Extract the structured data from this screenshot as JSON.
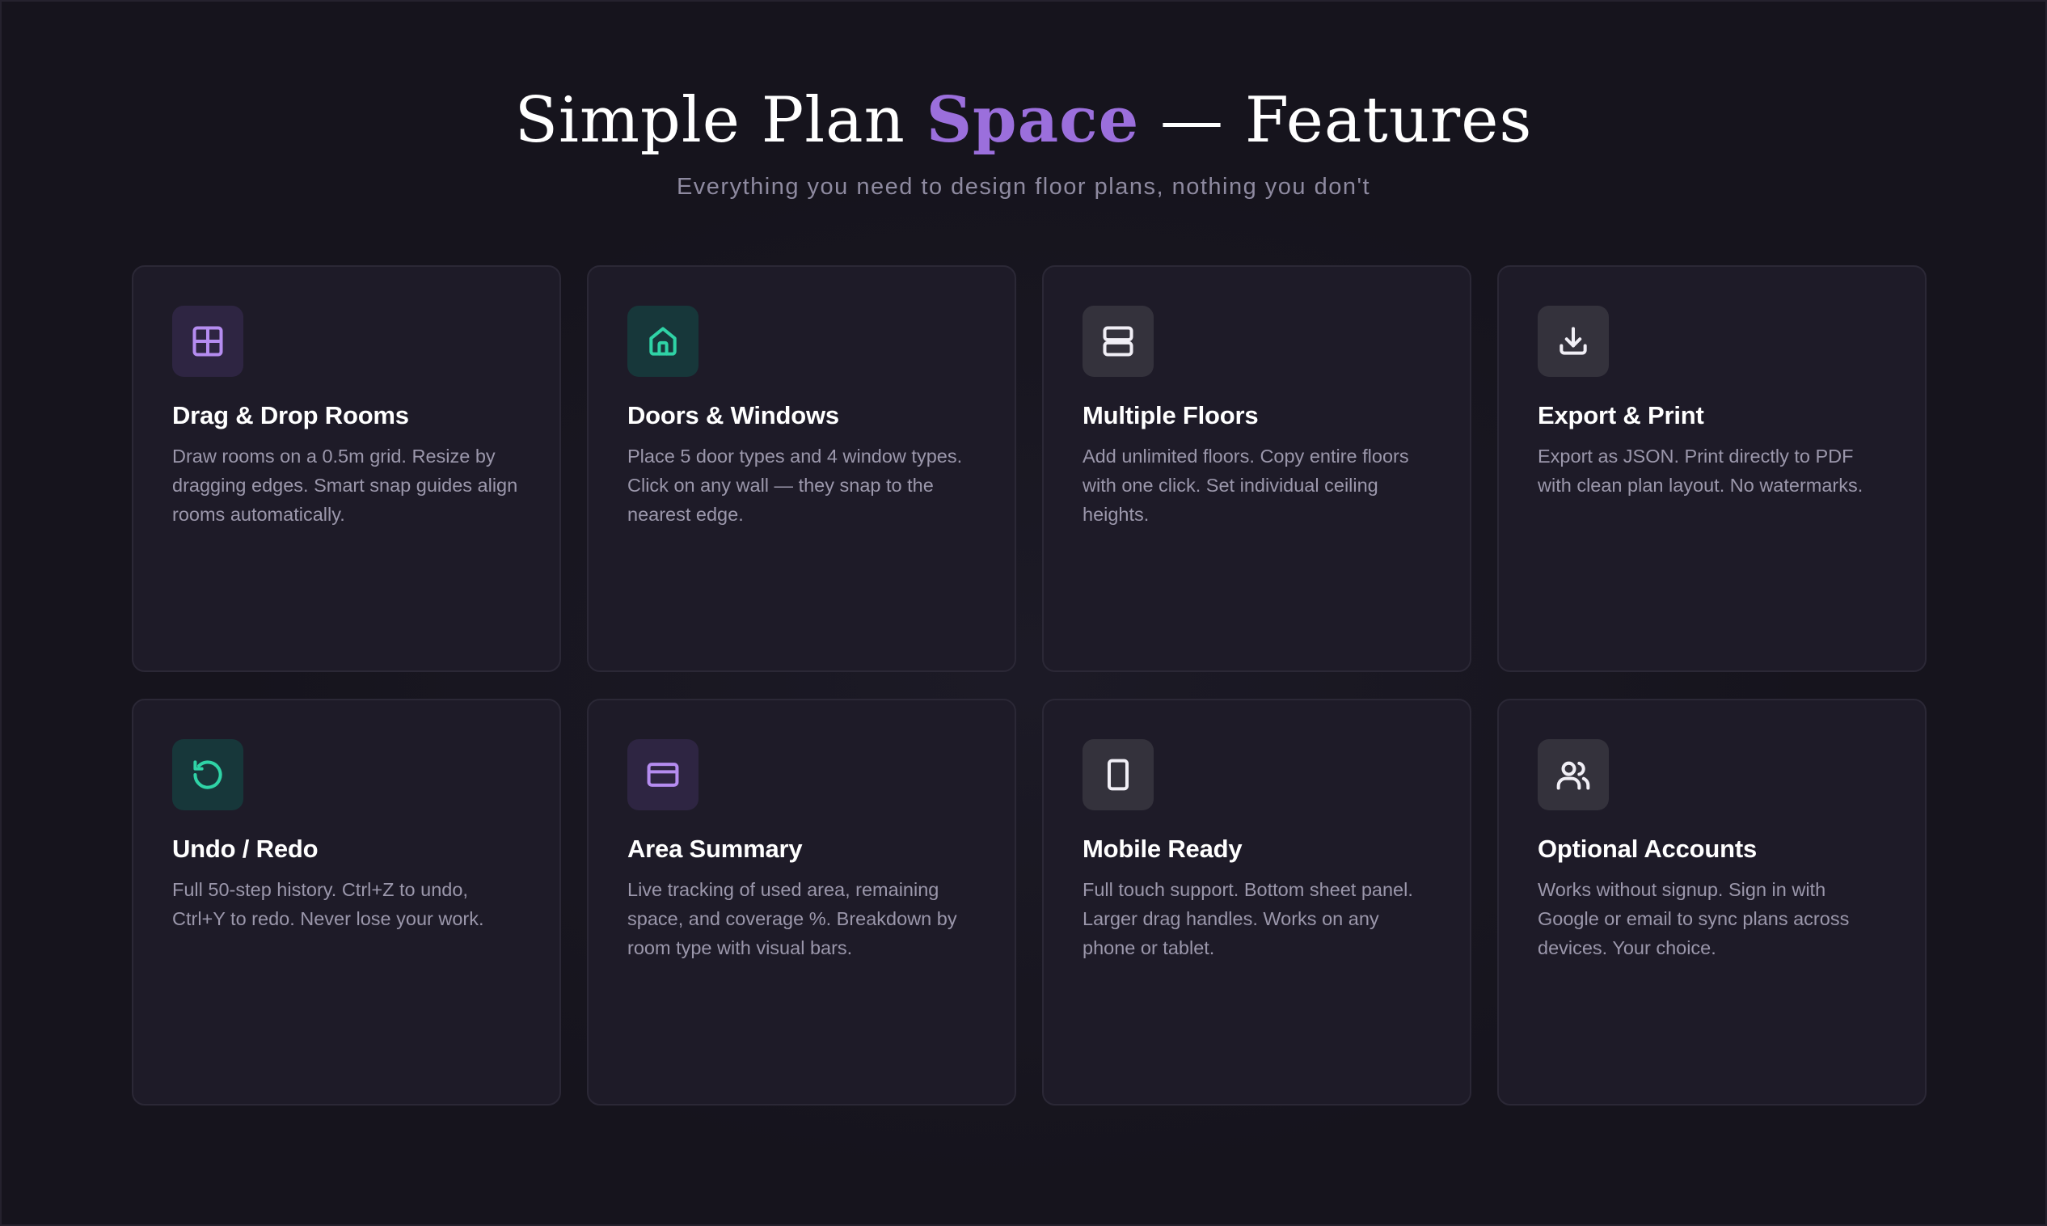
{
  "header": {
    "title_pre": "Simple Plan ",
    "title_accent": "Space",
    "title_post": " — Features",
    "subtitle": "Everything you need to design floor plans, nothing you don't"
  },
  "colors": {
    "accent_purple": "#9b6fdc",
    "accent_teal": "#2fd3a6",
    "background": "#16141d",
    "card": "#1e1b28"
  },
  "features": [
    {
      "icon": "grid-icon",
      "title": "Drag & Drop Rooms",
      "description": "Draw rooms on a 0.5m grid. Resize by dragging edges. Smart snap guides align rooms automatically."
    },
    {
      "icon": "home-icon",
      "title": "Doors & Windows",
      "description": "Place 5 door types and 4 window types. Click on any wall — they snap to the nearest edge."
    },
    {
      "icon": "layers-icon",
      "title": "Multiple Floors",
      "description": "Add unlimited floors. Copy entire floors with one click. Set individual ceiling heights."
    },
    {
      "icon": "download-icon",
      "title": "Export & Print",
      "description": "Export as JSON. Print directly to PDF with clean plan layout. No watermarks."
    },
    {
      "icon": "undo-icon",
      "title": "Undo / Redo",
      "description": "Full 50-step history. Ctrl+Z to undo, Ctrl+Y to redo. Never lose your work."
    },
    {
      "icon": "card-icon",
      "title": "Area Summary",
      "description": "Live tracking of used area, remaining space, and coverage %. Breakdown by room type with visual bars."
    },
    {
      "icon": "phone-icon",
      "title": "Mobile Ready",
      "description": "Full touch support. Bottom sheet panel. Larger drag handles. Works on any phone or tablet."
    },
    {
      "icon": "users-icon",
      "title": "Optional Accounts",
      "description": "Works without signup. Sign in with Google or email to sync plans across devices. Your choice."
    }
  ]
}
